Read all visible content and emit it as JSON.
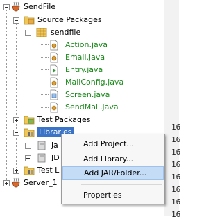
{
  "tree": {
    "project": "SendFile",
    "source_packages": "Source Packages",
    "package": "sendfile",
    "files": [
      "Action.java",
      "Email.java",
      "Entry.java",
      "MailConfig.java",
      "Screen.java",
      "SendMail.java"
    ],
    "test_packages": "Test Packages",
    "libraries": "Libraries",
    "library_children": [
      "ja",
      "JD"
    ],
    "test_libraries": "Test L",
    "server": "Server_1"
  },
  "editor": {
    "line_numbers": [
      "16",
      "16",
      "16",
      "16",
      "16",
      "16",
      "16",
      "16"
    ]
  },
  "context_menu": {
    "items": [
      "Add Project...",
      "Add Library...",
      "Add JAR/Folder...",
      "Properties"
    ],
    "highlighted": "Add JAR/Folder..."
  },
  "colors": {
    "selection": "#3b74c6",
    "java_file": "#1a8a1a",
    "menu_highlight": "#c5dcf6"
  }
}
